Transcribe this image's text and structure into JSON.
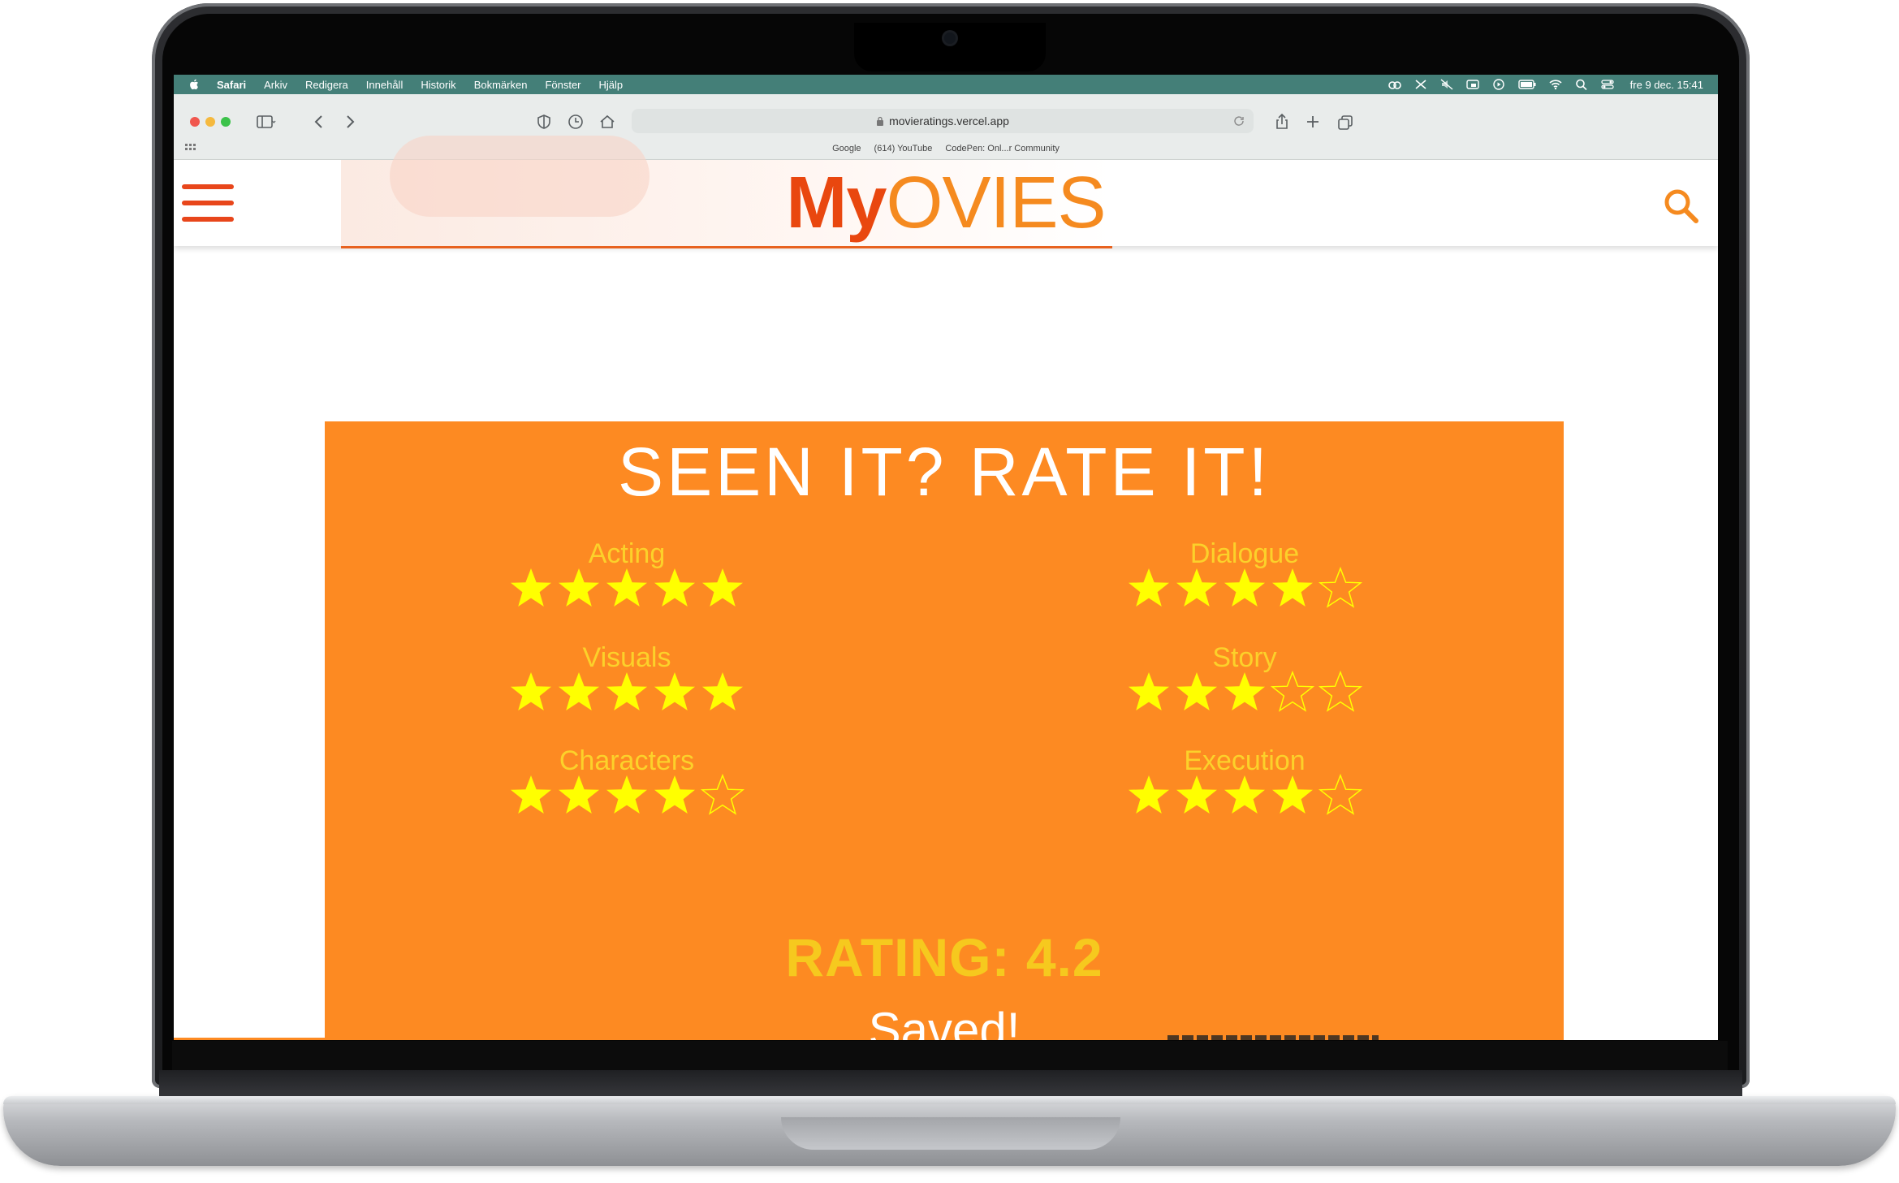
{
  "menubar": {
    "app_name": "Safari",
    "items": [
      "Arkiv",
      "Redigera",
      "Innehåll",
      "Historik",
      "Bokmärken",
      "Fönster",
      "Hjälp"
    ],
    "clock": "fre 9 dec.  15:41"
  },
  "browser": {
    "url": "movieratings.vercel.app",
    "favorites": [
      "Google",
      "(614) YouTube",
      "CodePen: Onl...r Community"
    ]
  },
  "site": {
    "logo_my": "My",
    "logo_ovies": "OVIES",
    "colors": {
      "brand_red": "#e9470f",
      "brand_orange": "#f58a1f",
      "card": "#fd8a22",
      "star": "#ffff00"
    }
  },
  "rating_card": {
    "title": "SEEN IT? RATE IT!",
    "criteria": [
      {
        "label": "Acting",
        "stars": 5,
        "max": 5
      },
      {
        "label": "Dialogue",
        "stars": 4,
        "max": 5
      },
      {
        "label": "Visuals",
        "stars": 5,
        "max": 5
      },
      {
        "label": "Story",
        "stars": 3,
        "max": 5
      },
      {
        "label": "Characters",
        "stars": 4,
        "max": 5
      },
      {
        "label": "Execution",
        "stars": 4,
        "max": 5
      }
    ],
    "rating_text": "RATING: 4.2",
    "saved_text": "Saved!"
  }
}
